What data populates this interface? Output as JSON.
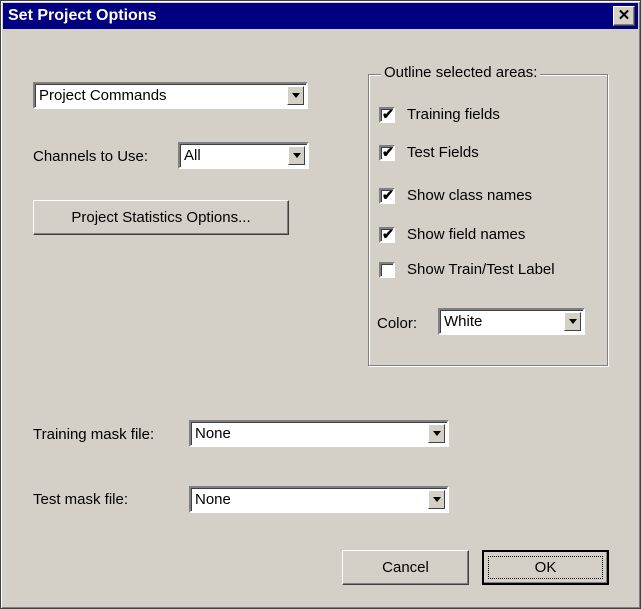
{
  "window": {
    "title": "Set Project Options",
    "close_glyph": "✕"
  },
  "project_commands": {
    "selected": "Project Commands"
  },
  "channels": {
    "label": "Channels to Use:",
    "selected": "All"
  },
  "stats_button": "Project Statistics Options...",
  "outline": {
    "legend": "Outline selected areas:",
    "items": [
      {
        "label": "Training fields",
        "checked": true
      },
      {
        "label": "Test Fields",
        "checked": true
      },
      {
        "label": "Show class names",
        "checked": true
      },
      {
        "label": "Show field names",
        "checked": true
      },
      {
        "label": "Show Train/Test Label",
        "checked": false
      }
    ],
    "color_label": "Color:",
    "color_selected": "White"
  },
  "training_mask": {
    "label": "Training mask file:",
    "selected": "None"
  },
  "test_mask": {
    "label": "Test mask file:",
    "selected": "None"
  },
  "buttons": {
    "cancel": "Cancel",
    "ok": "OK"
  },
  "check_glyph": "✔"
}
